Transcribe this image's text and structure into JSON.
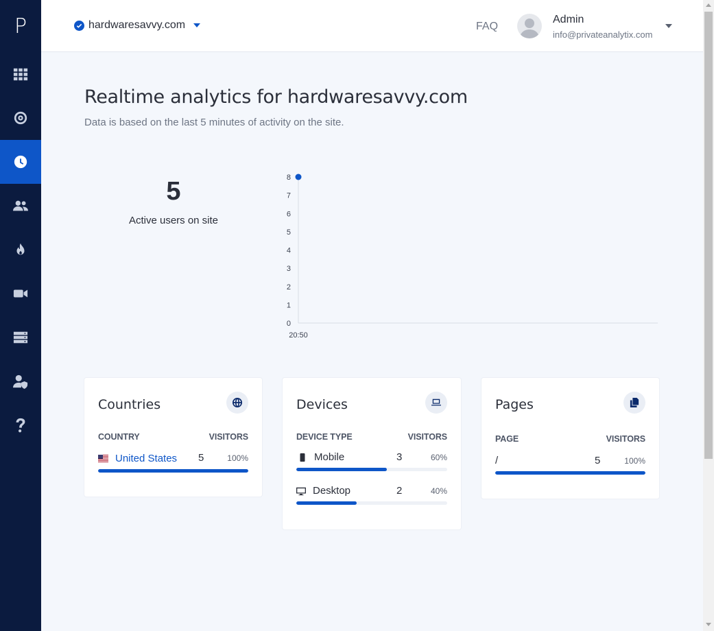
{
  "sidebar": {
    "logo": "P",
    "items": [
      {
        "icon": "grid-icon",
        "active": false
      },
      {
        "icon": "target-icon",
        "active": false
      },
      {
        "icon": "clock-icon",
        "active": true
      },
      {
        "icon": "users-icon",
        "active": false
      },
      {
        "icon": "fire-icon",
        "active": false
      },
      {
        "icon": "video-icon",
        "active": false
      },
      {
        "icon": "server-icon",
        "active": false
      },
      {
        "icon": "user-shield-icon",
        "active": false
      },
      {
        "icon": "question-icon",
        "active": false
      }
    ]
  },
  "header": {
    "site": "hardwaresavvy.com",
    "faq": "FAQ",
    "user_name": "Admin",
    "user_email": "info@privateanalytix.com"
  },
  "main": {
    "title": "Realtime analytics for hardwaresavvy.com",
    "subtitle": "Data is based on the last 5 minutes of activity on the site.",
    "active_users": "5",
    "active_users_label": "Active users on site"
  },
  "chart_data": {
    "type": "scatter",
    "x": [
      "20:50"
    ],
    "values": [
      8
    ],
    "ylim": [
      0,
      8
    ],
    "yticks": [
      "0",
      "1",
      "2",
      "3",
      "4",
      "5",
      "6",
      "7",
      "8"
    ],
    "grid": false,
    "color": "#0e56c8"
  },
  "countries": {
    "title": "Countries",
    "col_label": "COUNTRY",
    "col_visitors": "VISITORS",
    "rows": [
      {
        "label": "United States",
        "count": "5",
        "pct": "100%",
        "fraction": 1.0
      }
    ]
  },
  "devices": {
    "title": "Devices",
    "col_label": "DEVICE TYPE",
    "col_visitors": "VISITORS",
    "rows": [
      {
        "label": "Mobile",
        "count": "3",
        "pct": "60%",
        "fraction": 0.6,
        "icon": "mobile-icon"
      },
      {
        "label": "Desktop",
        "count": "2",
        "pct": "40%",
        "fraction": 0.4,
        "icon": "desktop-icon"
      }
    ]
  },
  "pages": {
    "title": "Pages",
    "col_label": "PAGE",
    "col_visitors": "VISITORS",
    "rows": [
      {
        "label": "/",
        "count": "5",
        "pct": "100%",
        "fraction": 1.0
      }
    ]
  },
  "colors": {
    "sidebar": "#0b1b3f",
    "accent": "#0e56c8",
    "background": "#f4f7fc"
  }
}
